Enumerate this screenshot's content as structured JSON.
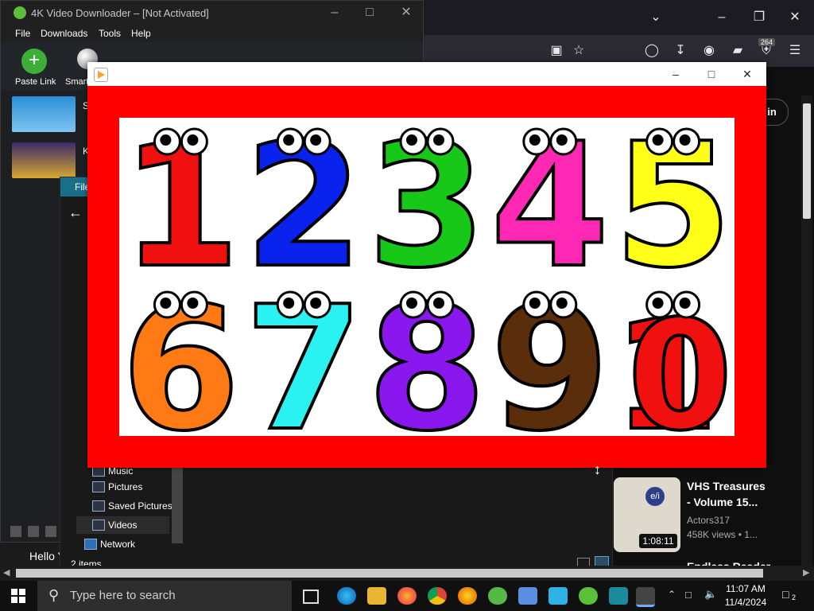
{
  "browser": {
    "badge_count": "264",
    "signin_label": "in"
  },
  "video_downloader": {
    "title": "4K Video Downloader – [Not Activated]",
    "menu": [
      "File",
      "Downloads",
      "Tools",
      "Help"
    ],
    "toolbar": {
      "paste_link": "Paste Link",
      "smart": "Smart"
    },
    "rows": [
      {
        "initial": "S"
      },
      {
        "initial": "K"
      }
    ],
    "hello_text": "Hello Y"
  },
  "file_explorer": {
    "ribbon_label": "File",
    "nav_items": [
      "Music",
      "Pictures",
      "Saved Pictures",
      "Videos",
      "Network"
    ],
    "status": "2 items"
  },
  "media_window": {
    "icon_color": "#f5a623",
    "numbers": [
      {
        "label": "1",
        "color": "#f01010"
      },
      {
        "label": "2",
        "color": "#0a22ee"
      },
      {
        "label": "3",
        "color": "#18c818"
      },
      {
        "label": "4",
        "color": "#ff28b4"
      },
      {
        "label": "5",
        "color": "#ffff18"
      },
      {
        "label": "6",
        "color": "#ff7a14"
      },
      {
        "label": "7",
        "color": "#2af2f2"
      },
      {
        "label": "8",
        "color": "#8a18ee"
      },
      {
        "label": "9",
        "color": "#5a2e0a"
      },
      {
        "label": "10",
        "color": "#f01010"
      }
    ]
  },
  "youtube_card": {
    "title_line1": "VHS Treasures",
    "title_line2": "- Volume 15...",
    "channel": "Actors317",
    "meta": "458K views • 1...",
    "duration": "1:08:11",
    "next_partial": "Endless Reader"
  },
  "taskbar": {
    "search_placeholder": "Type here to search",
    "time": "11:07 AM",
    "date": "11/4/2024",
    "notification_count": "2"
  }
}
